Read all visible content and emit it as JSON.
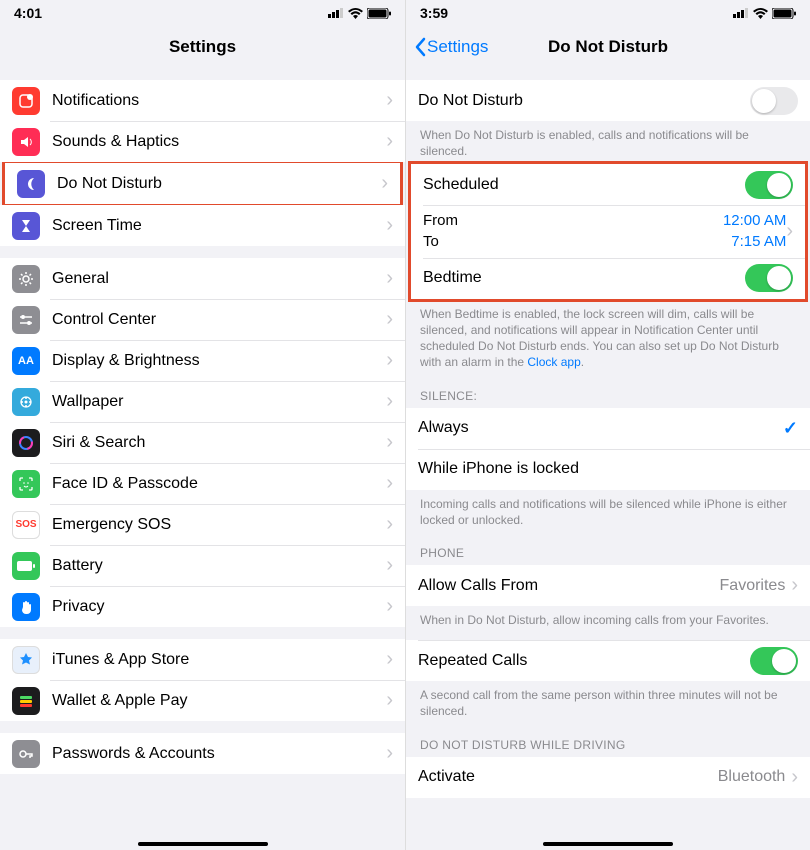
{
  "left": {
    "status_time": "4:01",
    "title": "Settings",
    "groups": [
      [
        {
          "icon_bg": "#ff3b30",
          "icon": "notifications",
          "label": "Notifications"
        },
        {
          "icon_bg": "#ff2d55",
          "icon": "sounds",
          "label": "Sounds & Haptics"
        },
        {
          "icon_bg": "#5856d6",
          "icon": "moon",
          "label": "Do Not Disturb",
          "highlight": true
        },
        {
          "icon_bg": "#5856d6",
          "icon": "hourglass",
          "label": "Screen Time"
        }
      ],
      [
        {
          "icon_bg": "#8e8e93",
          "icon": "gear",
          "label": "General"
        },
        {
          "icon_bg": "#8e8e93",
          "icon": "sliders",
          "label": "Control Center"
        },
        {
          "icon_bg": "#007aff",
          "icon": "brightness",
          "label": "Display & Brightness"
        },
        {
          "icon_bg": "#34aadc",
          "icon": "wallpaper",
          "label": "Wallpaper"
        },
        {
          "icon_bg": "#1c1c1e",
          "icon": "siri",
          "label": "Siri & Search"
        },
        {
          "icon_bg": "#34c759",
          "icon": "faceid",
          "label": "Face ID & Passcode"
        },
        {
          "icon_bg": "#ffffff",
          "icon": "sos",
          "label": "Emergency SOS"
        },
        {
          "icon_bg": "#34c759",
          "icon": "battery",
          "label": "Battery"
        },
        {
          "icon_bg": "#007aff",
          "icon": "hand",
          "label": "Privacy"
        }
      ],
      [
        {
          "icon_bg": "#e8f0fb",
          "icon": "appstore",
          "label": "iTunes & App Store"
        },
        {
          "icon_bg": "#1c1c1e",
          "icon": "wallet",
          "label": "Wallet & Apple Pay"
        }
      ],
      [
        {
          "icon_bg": "#8e8e93",
          "icon": "key",
          "label": "Passwords & Accounts"
        }
      ]
    ]
  },
  "right": {
    "status_time": "3:59",
    "back_label": "Settings",
    "title": "Do Not Disturb",
    "dnd": {
      "label": "Do Not Disturb",
      "on": false
    },
    "dnd_footer": "When Do Not Disturb is enabled, calls and notifications will be silenced.",
    "scheduled": {
      "label": "Scheduled",
      "on": true
    },
    "from_label": "From",
    "from_value": "12:00 AM",
    "to_label": "To",
    "to_value": "7:15 AM",
    "bedtime": {
      "label": "Bedtime",
      "on": true
    },
    "bedtime_footer_pre": "When Bedtime is enabled, the lock screen will dim, calls will be silenced, and notifications will appear in Notification Center until scheduled Do Not Disturb ends. You can also set up Do Not Disturb with an alarm in the ",
    "bedtime_footer_link": "Clock app",
    "bedtime_footer_post": ".",
    "silence_header": "SILENCE:",
    "silence_always": "Always",
    "silence_locked": "While iPhone is locked",
    "silence_footer": "Incoming calls and notifications will be silenced while iPhone is either locked or unlocked.",
    "phone_header": "PHONE",
    "allow_from": {
      "label": "Allow Calls From",
      "value": "Favorites"
    },
    "allow_footer": "When in Do Not Disturb, allow incoming calls from your Favorites.",
    "repeated": {
      "label": "Repeated Calls",
      "on": true
    },
    "repeated_footer": "A second call from the same person within three minutes will not be silenced.",
    "driving_header": "DO NOT DISTURB WHILE DRIVING",
    "activate": {
      "label": "Activate",
      "value": "Bluetooth"
    }
  }
}
